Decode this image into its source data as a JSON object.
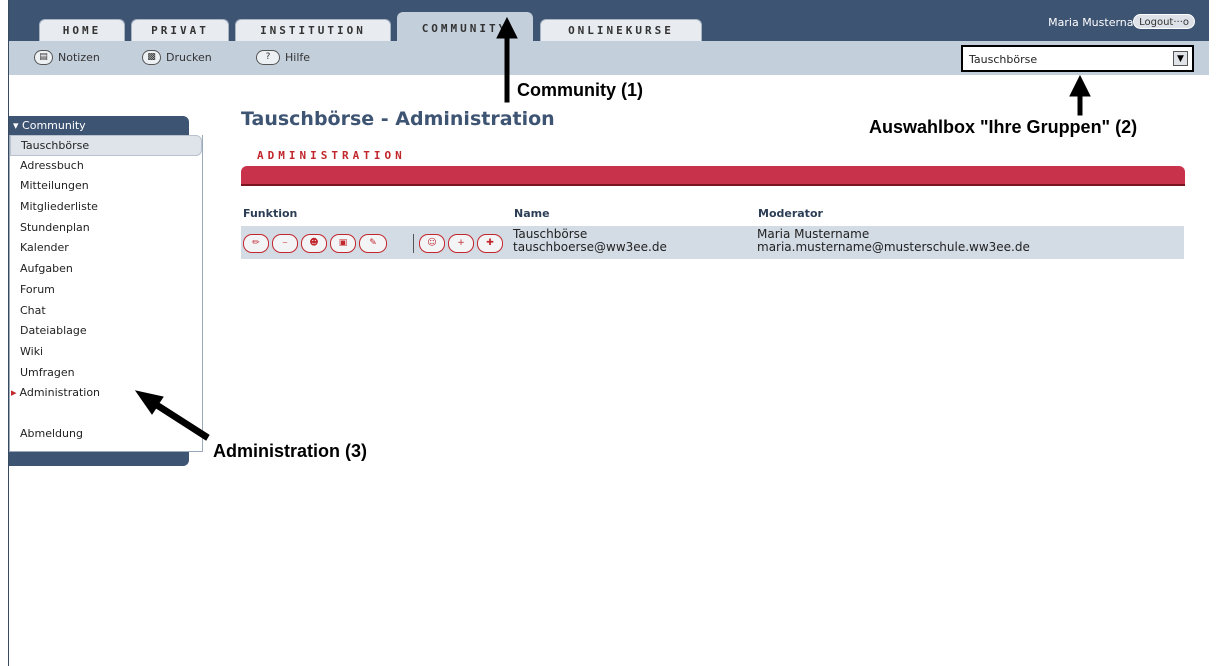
{
  "tabs": [
    "HOME",
    "PRIVAT",
    "INSTITUTION",
    "COMMUNITY",
    "ONLINEKURSE"
  ],
  "active_tab": "COMMUNITY",
  "user": {
    "name": "Maria Mustername",
    "logout": "Logout···o"
  },
  "toolbar": {
    "notizen": "Notizen",
    "drucken": "Drucken",
    "hilfe": "Hilfe"
  },
  "group_select": {
    "value": "Tauschbörse"
  },
  "sidebar": {
    "header": "Community",
    "items": [
      "Tauschbörse",
      "Adressbuch",
      "Mitteilungen",
      "Mitgliederliste",
      "Stundenplan",
      "Kalender",
      "Aufgaben",
      "Forum",
      "Chat",
      "Dateiablage",
      "Wiki",
      "Umfragen",
      "Administration"
    ],
    "logout": "Abmeldung",
    "active_item": "Tauschbörse",
    "current_item": "Administration"
  },
  "main": {
    "title": "Tauschbörse - Administration",
    "section": "ADMINISTRATION",
    "columns": {
      "funktion": "Funktion",
      "name": "Name",
      "moderator": "Moderator"
    },
    "row": {
      "name": "Tauschbörse",
      "email": "tauschboerse@ww3ee.de",
      "moderator": "Maria Mustername",
      "moderator_email": "maria.mustername@musterschule.ww3ee.de"
    }
  },
  "annotations": {
    "community": "Community (1)",
    "auswahl": "Auswahlbox \"Ihre Gruppen\" (2)",
    "admin": "Administration (3)"
  },
  "colors": {
    "nav": "#3e5473",
    "toolbar": "#c4cfdc",
    "accent": "#c8324a"
  }
}
